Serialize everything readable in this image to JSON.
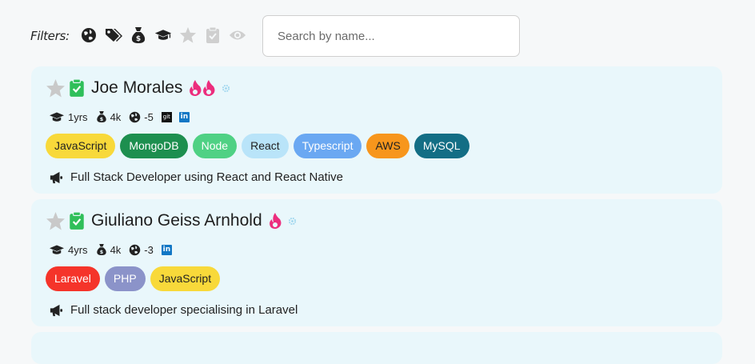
{
  "filters": {
    "label": "Filters:",
    "icons": [
      "globe-icon",
      "tags-icon",
      "money-bag-icon",
      "graduation-cap-icon",
      "star-icon",
      "clipboard-check-icon",
      "eye-icon"
    ]
  },
  "search": {
    "placeholder": "Search by name...",
    "value": ""
  },
  "candidates": [
    {
      "name": "Joe Morales",
      "fire_count": 2,
      "experience": "1yrs",
      "salary": "4k",
      "timezone": "-5",
      "github_label": "git",
      "linkedin_label": "in",
      "tags": [
        {
          "label": "JavaScript",
          "bg": "#f8d93a",
          "fg": "#222222"
        },
        {
          "label": "MongoDB",
          "bg": "#1d8f4f",
          "fg": "#ffffff"
        },
        {
          "label": "Node",
          "bg": "#4fd184",
          "fg": "#ffffff"
        },
        {
          "label": "React",
          "bg": "#b9e4f9",
          "fg": "#222222"
        },
        {
          "label": "Typescript",
          "bg": "#6aa8f2",
          "fg": "#ffffff"
        },
        {
          "label": "AWS",
          "bg": "#f7961c",
          "fg": "#222222"
        },
        {
          "label": "MySQL",
          "bg": "#136e85",
          "fg": "#ffffff"
        }
      ],
      "bio": "Full Stack Developer using React and React Native"
    },
    {
      "name": "Giuliano Geiss Arnhold",
      "fire_count": 1,
      "experience": "4yrs",
      "salary": "4k",
      "timezone": "-3",
      "linkedin_label": "in",
      "tags": [
        {
          "label": "Laravel",
          "bg": "#f5342a",
          "fg": "#ffffff"
        },
        {
          "label": "PHP",
          "bg": "#8b93c9",
          "fg": "#ffffff"
        },
        {
          "label": "JavaScript",
          "bg": "#f8d93a",
          "fg": "#222222"
        }
      ],
      "bio": "Full stack developer specialising in Laravel"
    }
  ],
  "colors": {
    "card_bg": "#e9f7fb",
    "fire": "#ec2d7d",
    "check_green": "#2fbf5a",
    "star_grey": "#c9c9c9",
    "linkedin": "#1277c5"
  }
}
